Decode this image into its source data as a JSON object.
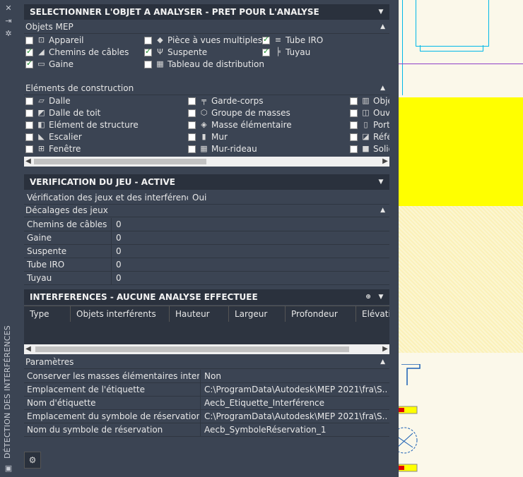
{
  "palette_title": "DÉTECTION DES INTERFÉRENCES",
  "sections": {
    "select": {
      "title": "SELECTIONNER L'OBJET A ANALYSER - PRET POUR L'ANALYSE"
    },
    "jeu": {
      "title": "VERIFICATION DU JEU - ACTIVE"
    },
    "interf": {
      "title": "INTERFERENCES - AUCUNE ANALYSE EFFECTUEE"
    }
  },
  "mep": {
    "header": "Objets MEP",
    "items": [
      {
        "label": "Appareil",
        "checked": false,
        "icon": "device-icon"
      },
      {
        "label": "Pièce à vues multiples",
        "checked": false,
        "icon": "multiview-part-icon"
      },
      {
        "label": "Tube IRO",
        "checked": true,
        "icon": "conduit-icon"
      },
      {
        "label": "Chemins de câbles",
        "checked": true,
        "icon": "cable-tray-icon"
      },
      {
        "label": "Suspente",
        "checked": true,
        "icon": "hanger-icon"
      },
      {
        "label": "Tuyau",
        "checked": true,
        "icon": "pipe-icon"
      },
      {
        "label": "Gaine",
        "checked": true,
        "icon": "duct-icon"
      },
      {
        "label": "Tableau de distribution",
        "checked": false,
        "icon": "panel-icon"
      }
    ]
  },
  "construction": {
    "header": "Eléments de construction",
    "items": [
      {
        "label": "Dalle",
        "checked": false,
        "icon": "slab-icon"
      },
      {
        "label": "Garde-corps",
        "checked": false,
        "icon": "railing-icon"
      },
      {
        "label": "Obje",
        "checked": false,
        "icon": "object-icon"
      },
      {
        "label": "Dalle de toit",
        "checked": false,
        "icon": "roof-slab-icon"
      },
      {
        "label": "Groupe de masses",
        "checked": false,
        "icon": "mass-group-icon"
      },
      {
        "label": "Ouve",
        "checked": false,
        "icon": "opening-icon"
      },
      {
        "label": "Elément de structure",
        "checked": false,
        "icon": "structure-icon"
      },
      {
        "label": "Masse élémentaire",
        "checked": false,
        "icon": "mass-element-icon"
      },
      {
        "label": "Port",
        "checked": false,
        "icon": "door-icon"
      },
      {
        "label": "Escalier",
        "checked": false,
        "icon": "stair-icon"
      },
      {
        "label": "Mur",
        "checked": false,
        "icon": "wall-icon"
      },
      {
        "label": "Réfé",
        "checked": false,
        "icon": "reference-icon"
      },
      {
        "label": "Fenêtre",
        "checked": false,
        "icon": "window-icon"
      },
      {
        "label": "Mur-rideau",
        "checked": false,
        "icon": "curtain-wall-icon"
      },
      {
        "label": "Solid",
        "checked": false,
        "icon": "solid-icon"
      }
    ]
  },
  "jeu": {
    "row": {
      "key": "Vérification des jeux et des interférences l...",
      "value": "Oui"
    },
    "offsets_header": "Décalages des jeux",
    "offsets": [
      {
        "key": "Chemins de câbles",
        "value": "0"
      },
      {
        "key": "Gaine",
        "value": "0"
      },
      {
        "key": "Suspente",
        "value": "0"
      },
      {
        "key": "Tube IRO",
        "value": "0"
      },
      {
        "key": "Tuyau",
        "value": "0"
      }
    ]
  },
  "interf": {
    "columns": [
      "Type",
      "Objets interférents",
      "Hauteur",
      "Largeur",
      "Profondeur",
      "Elévation"
    ]
  },
  "params": {
    "header": "Paramètres",
    "rows": [
      {
        "key": "Conserver les masses élémentaires interféren...",
        "value": "Non"
      },
      {
        "key": "Emplacement de l'étiquette",
        "value": "C:\\ProgramData\\Autodesk\\MEP 2021\\fra\\S..."
      },
      {
        "key": "Nom d'étiquette",
        "value": "Aecb_Etiquette_Interférence"
      },
      {
        "key": "Emplacement du symbole de réservation",
        "value": "C:\\ProgramData\\Autodesk\\MEP 2021\\fra\\S..."
      },
      {
        "key": "Nom du symbole de réservation",
        "value": "Aecb_SymboleRéservation_1"
      }
    ]
  }
}
